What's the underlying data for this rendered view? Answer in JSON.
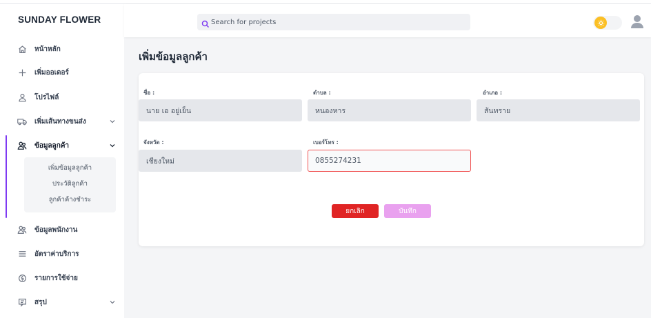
{
  "brand": "SUNDAY FLOWER",
  "search": {
    "placeholder": "Search for projects"
  },
  "nav": {
    "home": "หน้าหลัก",
    "add_order": "เพิ่มออเดอร์",
    "profile": "โปรไฟล์",
    "add_route": "เพิ่มเส้นทางขนส่ง",
    "customer_info": "ข้อมูลลูกค้า",
    "employee_info": "ข้อมูลพนักงาน",
    "service_rates": "อัตราค่าบริการ",
    "expenses": "รายการใช้จ่าย",
    "summary": "สรุป"
  },
  "submenu": {
    "add_customer": "เพิ่มข้อมูลลูกค้า",
    "customer_history": "ประวัติลูกค้า",
    "customer_outstanding": "ลูกค้าค้างชำระ"
  },
  "page": {
    "title": "เพิ่มข้อมูลลูกค้า"
  },
  "form": {
    "name_label": "ชื่อ :",
    "name_value": "นาย เอ อยู่เย็น",
    "subdistrict_label": "ตำบล :",
    "subdistrict_value": "หนองหาร",
    "district_label": "อำเภอ :",
    "district_value": "สันทราย",
    "province_label": "จังหวัด :",
    "province_value": "เชียงใหม่",
    "phone_label": "เบอร์โทร :",
    "phone_value": "0855274231"
  },
  "buttons": {
    "cancel": "ยกเลิก",
    "save": "บันทึก"
  },
  "colors": {
    "accent": "#7e3af2",
    "cancel": "#e02424",
    "save": "#e9a1ef",
    "error_border": "#f05252",
    "theme_toggle": "#fbbf24"
  },
  "icons": {
    "home": "home-icon",
    "add_order": "plus-icon",
    "profile": "user-icon",
    "add_route": "truck-icon",
    "customer_info": "users-icon",
    "employee_info": "users-icon",
    "service_rates": "menu-lines-icon",
    "expenses": "coin-icon",
    "summary": "chat-icon",
    "search": "search-icon",
    "theme": "sun-icon",
    "avatar": "user-avatar-icon"
  }
}
